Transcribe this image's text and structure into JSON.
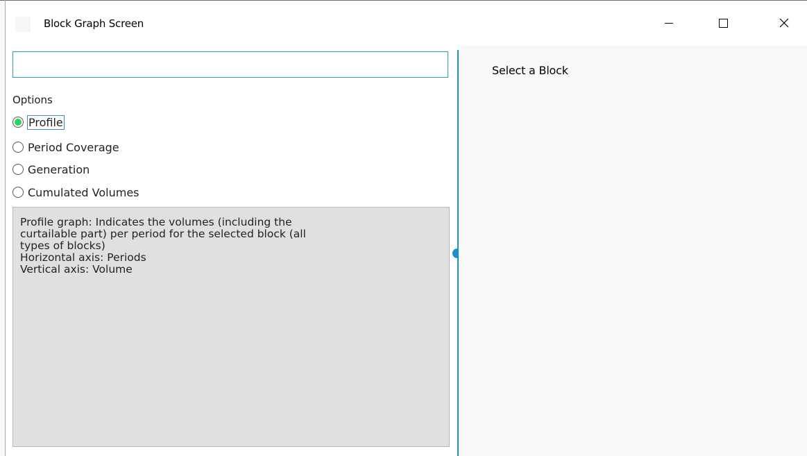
{
  "window": {
    "title": "Block Graph Screen"
  },
  "search": {
    "value": "",
    "placeholder": ""
  },
  "options": {
    "label": "Options",
    "items": [
      {
        "label": "Profile",
        "selected": true
      },
      {
        "label": "Period Coverage",
        "selected": false
      },
      {
        "label": "Generation",
        "selected": false
      },
      {
        "label": "Cumulated Volumes",
        "selected": false
      }
    ]
  },
  "description": {
    "lines": [
      "Profile graph: Indicates the volumes (including the",
      "curtailable part) per period for the selected block (all",
      "types of blocks)",
      "Horizontal axis: Periods",
      "Vertical axis: Volume"
    ]
  },
  "right_pane": {
    "message": "Select a Block"
  },
  "colors": {
    "accent": "#1f8fc9",
    "search_border": "#2aa0ad",
    "radio_selected": "#22d866",
    "description_bg": "#e0e0e0"
  }
}
